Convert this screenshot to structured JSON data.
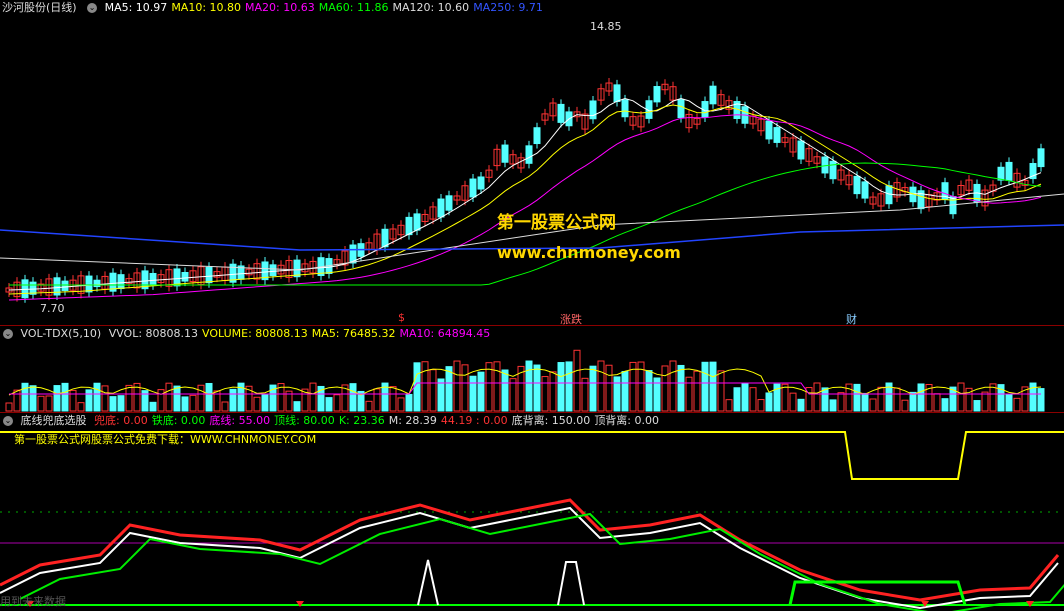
{
  "main": {
    "title": "沙河股份(日线)",
    "ma": [
      {
        "label": "MA5: 10.97",
        "color": "#ffffff"
      },
      {
        "label": "MA10: 10.80",
        "color": "#ffff00"
      },
      {
        "label": "MA20: 10.63",
        "color": "#ff00ff"
      },
      {
        "label": "MA60: 11.86",
        "color": "#00ff00"
      },
      {
        "label": "MA120: 10.60",
        "color": "#dddddd"
      },
      {
        "label": "MA250: 9.71",
        "color": "#3355ff"
      }
    ],
    "high_label": "14.85",
    "low_label": "7.70",
    "watermark1": "第一股票公式网",
    "watermark2": "www.chnmoney.com",
    "markers": [
      {
        "text": "$",
        "color": "#ff3333"
      },
      {
        "text": "涨跌",
        "color": "#ff6666"
      },
      {
        "text": "财",
        "color": "#88ccff"
      }
    ]
  },
  "vol": {
    "title": "VOL-TDX(5,10)",
    "fields": [
      {
        "label": "VVOL: 80808.13",
        "color": "#dddddd"
      },
      {
        "label": "VOLUME: 80808.13",
        "color": "#ffff00"
      },
      {
        "label": "MA5: 76485.32",
        "color": "#ffff00"
      },
      {
        "label": "MA10: 64894.45",
        "color": "#ff00ff"
      }
    ]
  },
  "ind": {
    "title": "底线兜底选股",
    "fields": [
      {
        "label": "兜底: 0.00",
        "color": "#ff3333"
      },
      {
        "label": "铁底: 0.00",
        "color": "#00ff00"
      },
      {
        "label": "底线: 55.00",
        "color": "#ff00ff"
      },
      {
        "label": "顶线: 80.00",
        "color": "#00ff00"
      },
      {
        "label": "K: 23.36",
        "color": "#00ff00"
      },
      {
        "label": "M: 28.39",
        "color": "#dddddd"
      },
      {
        "label": "44.19 : 0.00",
        "color": "#ff3333"
      },
      {
        "label": "底背离: 150.00",
        "color": "#dddddd"
      },
      {
        "label": "顶背离: 0.00",
        "color": "#dddddd"
      }
    ],
    "promo": "第一股票公式网股票公式免费下载：WWW.CHNMONEY.COM"
  },
  "footer": "用到未来数据"
}
